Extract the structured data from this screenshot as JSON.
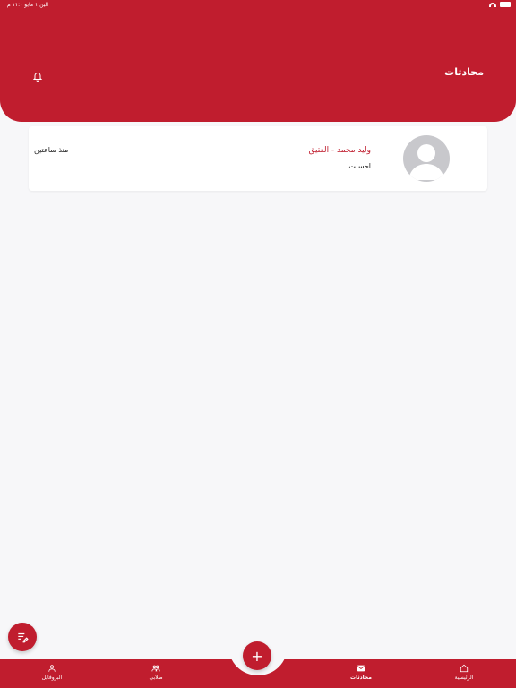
{
  "status": {
    "left_text": "الين ١ مايو ١١:٠ م"
  },
  "header": {
    "title": "محادثات"
  },
  "conversations": [
    {
      "name": "وليد محمد - العتيق",
      "message": "احسنت",
      "time": "منذ ساعتين"
    }
  ],
  "bottom_nav": {
    "home": "الرئيسية",
    "chats": "محادثات",
    "students": "طلابي",
    "profile": "البروفايل",
    "add": "+"
  },
  "colors": {
    "primary": "#c01d2e",
    "background": "#f7f7f9"
  }
}
